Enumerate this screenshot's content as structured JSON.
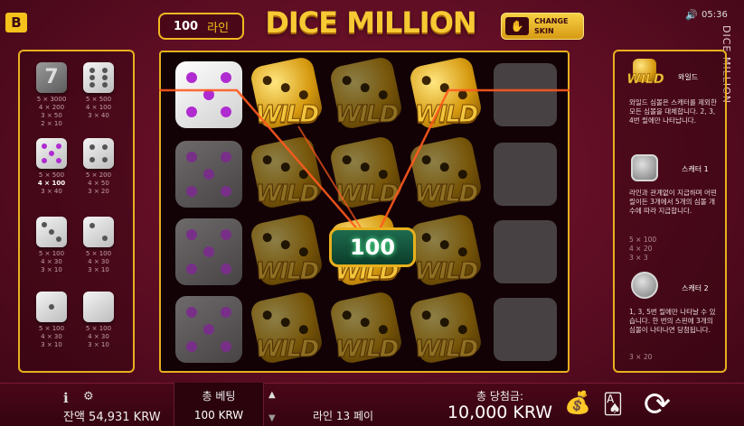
{
  "header": {
    "logo": "B",
    "lines_count": "100",
    "lines_label": "라인",
    "title": "DICE MILLION",
    "change_skin": "CHANGE SKIN",
    "clock": "05:36",
    "vertical_title": "DICE MILLION"
  },
  "paytable": [
    {
      "symbol": "seven",
      "pays": [
        "5 × 3000",
        "4 × 200",
        "3 × 50",
        "2 × 10"
      ],
      "highlight": -1
    },
    {
      "symbol": "six",
      "pays": [
        "5 × 500",
        "4 × 100",
        "3 × 40"
      ],
      "highlight": -1
    },
    {
      "symbol": "five",
      "pays": [
        "5 × 500",
        "4 × 100",
        "3 × 40"
      ],
      "highlight": 1
    },
    {
      "symbol": "four",
      "pays": [
        "5 × 200",
        "4 × 50",
        "3 × 20"
      ],
      "highlight": -1
    },
    {
      "symbol": "three",
      "pays": [
        "5 × 100",
        "4 × 30",
        "3 × 10"
      ],
      "highlight": -1
    },
    {
      "symbol": "two",
      "pays": [
        "5 × 100",
        "4 × 30",
        "3 × 10"
      ],
      "highlight": -1
    },
    {
      "symbol": "one-a",
      "pays": [
        "5 × 100",
        "4 × 30",
        "3 × 10"
      ],
      "highlight": -1
    },
    {
      "symbol": "one-b",
      "pays": [
        "5 × 100",
        "4 × 30",
        "3 × 10"
      ],
      "highlight": -1
    }
  ],
  "reels": {
    "wild_text": "WILD",
    "win_amount": "100"
  },
  "info": {
    "wild_label": "와일드",
    "wild_desc": "와일드 심볼은 스캐터를 제외한 모든 심볼을 대체합니다. 2, 3, 4번 릴에만 나타납니다.",
    "scatter1_label": "스캐터 1",
    "scatter1_desc": "라인과 관계없이 지급하며 어떤 릴이든 3개에서 5개의 심볼 개수에 따라 지급합니다.",
    "scatter1_pays": [
      "5 × 100",
      "4 × 20",
      "3 × 3"
    ],
    "scatter2_label": "스캐터 2",
    "scatter2_desc": "1, 3, 5번 릴에만 나타날 수 있습니다. 한 번의 스핀에 3개의 심볼이 나타나면 당첨됩니다.",
    "scatter2_pays": [
      "3 × 20"
    ]
  },
  "footer": {
    "balance": "잔액 54,931 KRW",
    "bet_label": "총 베팅",
    "bet_value": "100 KRW",
    "lines_pay": "라인 13 페이",
    "total_win_label": "총 당첨금:",
    "total_win_value": "10,000 KRW"
  },
  "colors": {
    "gold": "#e7b01e",
    "background": "#5a0b1e",
    "purple_pip": "#b02bd0"
  }
}
